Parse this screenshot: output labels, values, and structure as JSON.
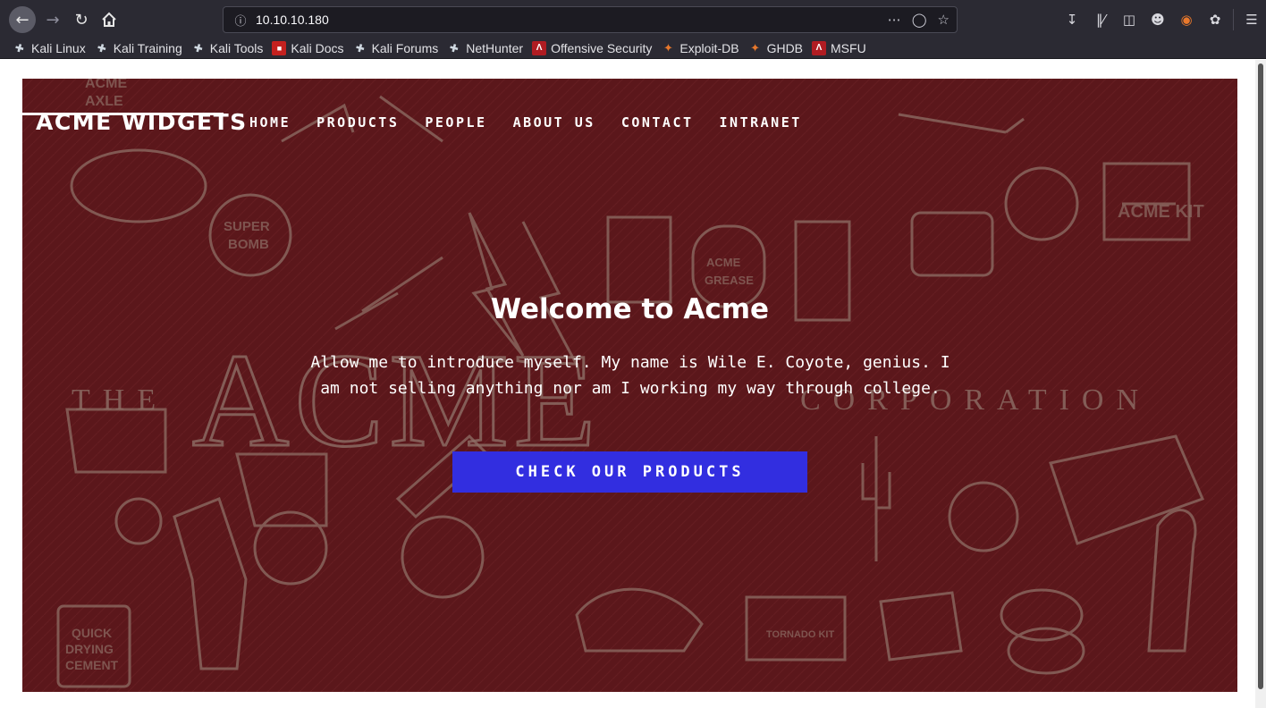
{
  "browser": {
    "url": "10.10.10.180",
    "bookmarks": [
      {
        "label": "Kali Linux",
        "icon": "kali-dragon-icon"
      },
      {
        "label": "Kali Training",
        "icon": "kali-dragon-icon"
      },
      {
        "label": "Kali Tools",
        "icon": "kali-dragon-icon"
      },
      {
        "label": "Kali Docs",
        "icon": "pdf-icon"
      },
      {
        "label": "Kali Forums",
        "icon": "kali-dragon-icon"
      },
      {
        "label": "NetHunter",
        "icon": "kali-dragon-icon"
      },
      {
        "label": "Offensive Security",
        "icon": "offsec-icon"
      },
      {
        "label": "Exploit-DB",
        "icon": "exploitdb-icon"
      },
      {
        "label": "GHDB",
        "icon": "exploitdb-icon"
      },
      {
        "label": "MSFU",
        "icon": "offsec-icon"
      }
    ]
  },
  "site": {
    "brand": "ACME WIDGETS",
    "nav": [
      "HOME",
      "PRODUCTS",
      "PEOPLE",
      "ABOUT US",
      "CONTACT",
      "INTRANET"
    ],
    "hero": {
      "title": "Welcome to Acme",
      "text": "Allow me to introduce myself. My name is Wile E. Coyote, genius. I am not selling anything nor am I working my way through college.",
      "cta": "CHECK OUR PRODUCTS"
    }
  },
  "colors": {
    "hero_bg": "#5b171b",
    "cta_bg": "#322ee0",
    "chrome_bg": "#2b2a33"
  }
}
